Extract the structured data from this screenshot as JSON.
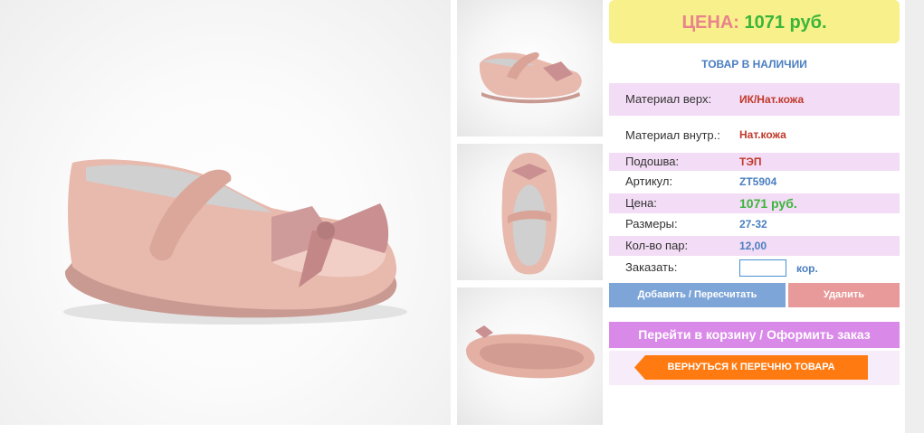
{
  "price": {
    "label": "ЦЕНА:",
    "value": "1071 руб."
  },
  "availability": "ТОВАР В НАЛИЧИИ",
  "details": [
    {
      "label": "Материал верх:",
      "value": "ИК/Нат.кожа"
    },
    {
      "label": "Материал внутр.:",
      "value": "Нат.кожа"
    },
    {
      "label": "Подошва:",
      "value": "ТЭП"
    },
    {
      "label": "Артикул:",
      "value": "ZT5904"
    },
    {
      "label": "Цена:",
      "value": "1071 руб."
    },
    {
      "label": "Размеры:",
      "value": "27-32"
    },
    {
      "label": "Кол-во пар:",
      "value": "12,00"
    }
  ],
  "order": {
    "label": "Заказать:",
    "value": "",
    "unit": "кор."
  },
  "buttons": {
    "add": "Добавить / Пересчитать",
    "delete": "Удалить",
    "cart": "Перейти в корзину / Оформить заказ",
    "back": "ВЕРНУТЬСЯ К ПЕРЕЧНЮ ТОВАРА"
  },
  "colors": {
    "price_bg": "#f8f08a",
    "price_label": "#e8828c",
    "price_value": "#3ab53a",
    "row_pink": "#f3dcf5",
    "add_button": "#7ea5d8",
    "delete_button": "#e89a9a",
    "cart_button": "#d98ae8",
    "back_button": "#ff7a10"
  }
}
